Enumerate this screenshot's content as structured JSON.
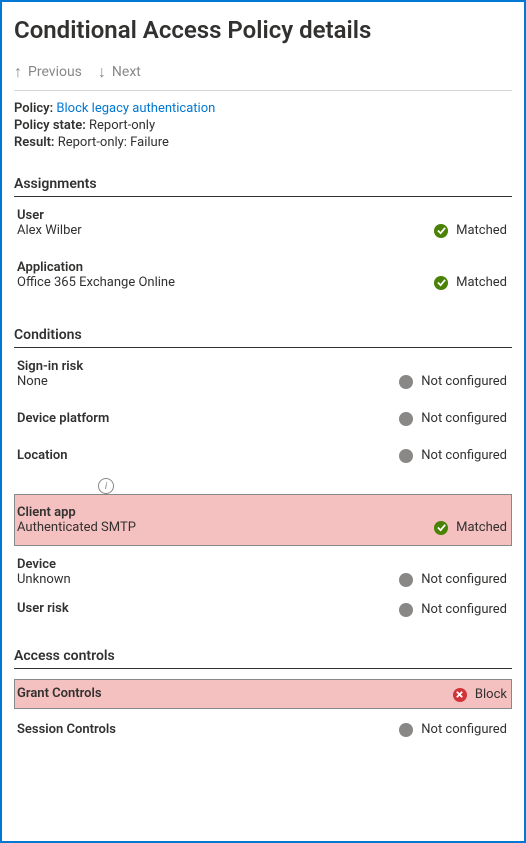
{
  "header": {
    "title": "Conditional Access Policy details",
    "prev_label": "Previous",
    "next_label": "Next"
  },
  "meta": {
    "policy_label": "Policy:",
    "policy_value": "Block legacy authentication",
    "state_label": "Policy state:",
    "state_value": "Report-only",
    "result_label": "Result:",
    "result_value": "Report-only: Failure"
  },
  "sections": {
    "assignments": "Assignments",
    "conditions": "Conditions",
    "access_controls": "Access controls"
  },
  "status_text": {
    "matched": "Matched",
    "not_configured": "Not configured",
    "block": "Block"
  },
  "assignments": {
    "user_label": "User",
    "user_value": "Alex Wilber",
    "app_label": "Application",
    "app_value": "Office 365 Exchange Online"
  },
  "conditions": {
    "signin_risk_label": "Sign-in risk",
    "signin_risk_value": "None",
    "device_platform_label": "Device platform",
    "location_label": "Location",
    "client_app_label": "Client app",
    "client_app_value": "Authenticated SMTP",
    "device_label": "Device",
    "device_value": "Unknown",
    "user_risk_label": "User risk"
  },
  "access": {
    "grant_label": "Grant Controls",
    "session_label": "Session Controls"
  }
}
